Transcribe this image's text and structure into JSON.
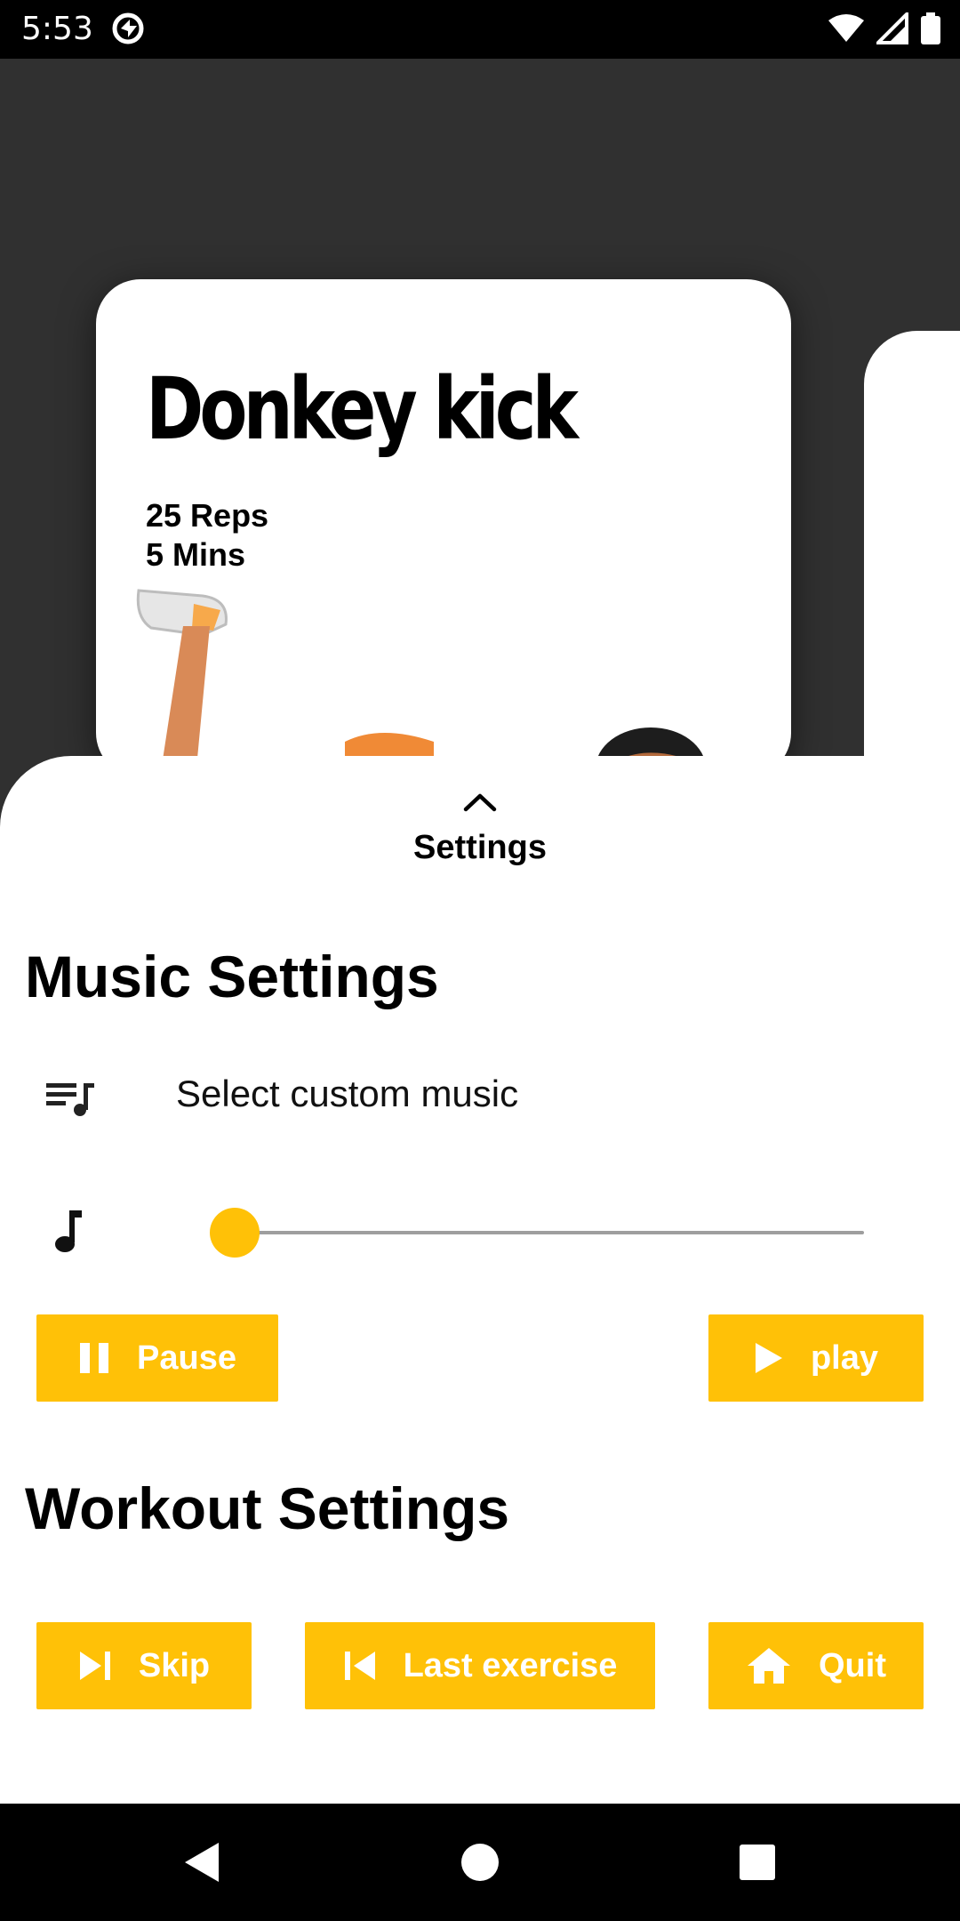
{
  "status_bar": {
    "time": "5:53"
  },
  "card": {
    "title": "Donkey kick",
    "reps": "25 Reps",
    "duration": "5 Mins"
  },
  "sheet": {
    "title": "Settings",
    "music_section_title": "Music Settings",
    "select_music_label": "Select custom music",
    "volume_level": 0.0,
    "pause_label": "Pause",
    "play_label": "play",
    "workout_section_title": "Workout Settings",
    "skip_label": "Skip",
    "last_exercise_label": "Last exercise",
    "quit_label": "Quit"
  },
  "colors": {
    "accent": "#ffc107",
    "background": "#303030",
    "sheet": "#ffffff"
  },
  "icons": [
    "chevron-up-icon",
    "playlist-icon",
    "music-note-icon",
    "pause-icon",
    "play-icon",
    "skip-next-icon",
    "skip-previous-icon",
    "home-icon"
  ]
}
